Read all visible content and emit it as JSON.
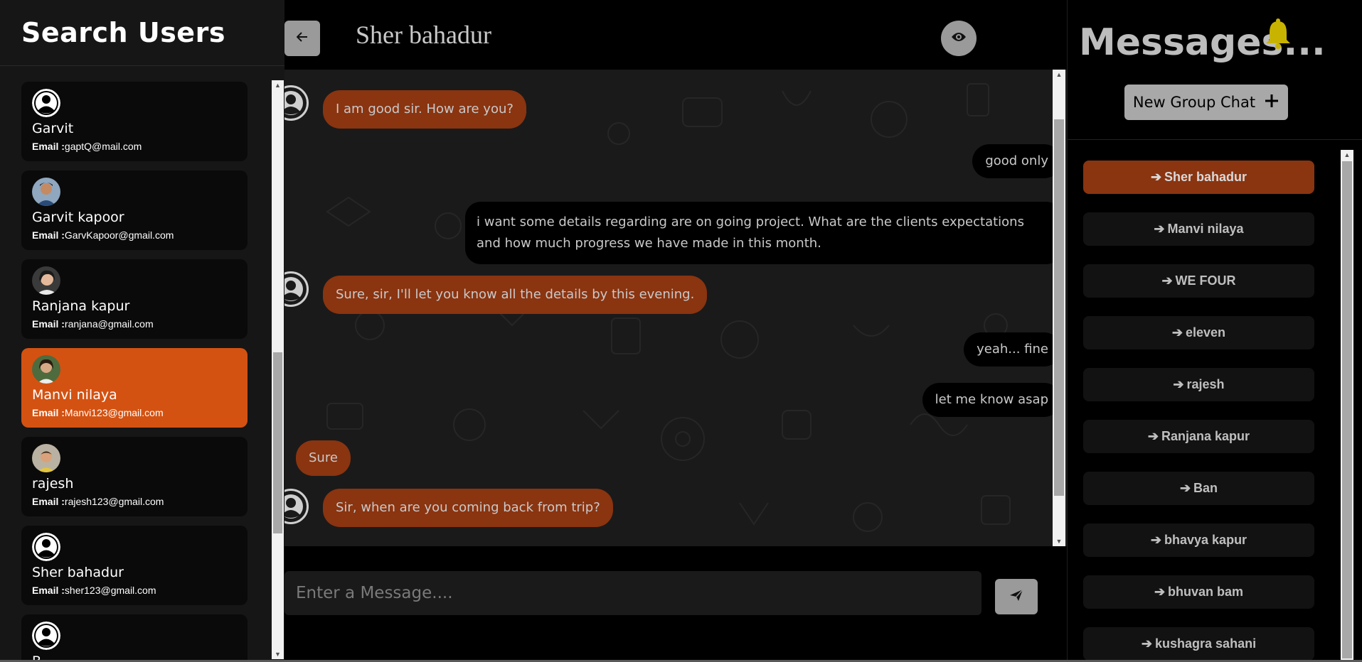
{
  "drawer": {
    "title": "Search Users",
    "email_label": "Email :",
    "users": [
      {
        "name": "Garvit",
        "email": "gaptQ@mail.com",
        "avatar": "default"
      },
      {
        "name": "Garvit kapoor",
        "email": "GarvKapoor@gmail.com",
        "avatar": "photo"
      },
      {
        "name": "Ranjana kapur",
        "email": "ranjana@gmail.com",
        "avatar": "photo"
      },
      {
        "name": "Manvi nilaya",
        "email": "Manvi123@gmail.com",
        "avatar": "photo",
        "selected": true
      },
      {
        "name": "rajesh",
        "email": "rajesh123@gmail.com",
        "avatar": "photo"
      },
      {
        "name": "Sher bahadur",
        "email": "sher123@gmail.com",
        "avatar": "default"
      },
      {
        "name": "B...",
        "email": "",
        "avatar": "default"
      }
    ]
  },
  "chat": {
    "name": "Sher bahadur",
    "back_icon": "arrow-left-icon",
    "view_icon": "eye-icon",
    "messages": [
      {
        "side": "in",
        "text": "I am good sir. How are you?",
        "avatar": true
      },
      {
        "side": "out",
        "text": "good only"
      },
      {
        "side": "out",
        "text": "i want some details regarding are on going project. What are the clients expectations and how much progress we have made in this month."
      },
      {
        "side": "in",
        "text": "Sure, sir, I'll let you know all the details by this evening.",
        "avatar": true
      },
      {
        "side": "out",
        "text": "yeah... fine"
      },
      {
        "side": "out",
        "text": "let me know asap"
      },
      {
        "side": "in",
        "text": "Sure",
        "avatar": false
      },
      {
        "side": "in",
        "text": "Sir, when are you coming back from trip?",
        "avatar": true
      }
    ],
    "input_placeholder": "Enter a Message....",
    "send_icon": "paper-plane-icon"
  },
  "messages_panel": {
    "title": "Messages...",
    "bell_icon": "bell-icon",
    "new_group_label": "New Group Chat",
    "chats": [
      {
        "name": "Sher bahadur",
        "active": true
      },
      {
        "name": "Manvi nilaya"
      },
      {
        "name": "WE FOUR"
      },
      {
        "name": "eleven"
      },
      {
        "name": "rajesh"
      },
      {
        "name": "Ranjana kapur"
      },
      {
        "name": "Ban"
      },
      {
        "name": "bhavya kapur"
      },
      {
        "name": "bhuvan bam"
      },
      {
        "name": "kushagra sahani"
      }
    ]
  },
  "colors": {
    "accent": "#d35212",
    "bubble_in": "#8a3410",
    "bell": "#c8b400"
  }
}
